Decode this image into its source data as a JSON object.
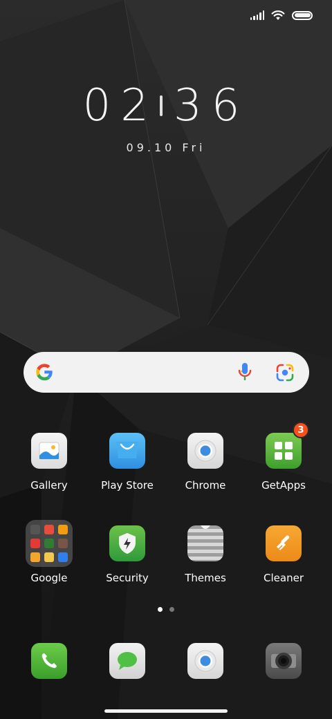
{
  "clock": {
    "hours": "02",
    "minutes": "36"
  },
  "date": {
    "text": "09.10 Fri"
  },
  "apps": [
    {
      "label": "Gallery"
    },
    {
      "label": "Play Store"
    },
    {
      "label": "Chrome"
    },
    {
      "label": "GetApps",
      "badge": "3"
    },
    {
      "label": "Google"
    },
    {
      "label": "Security"
    },
    {
      "label": "Themes"
    },
    {
      "label": "Cleaner"
    }
  ],
  "dock": [
    {
      "icon": "phone-icon"
    },
    {
      "icon": "messaging-icon"
    },
    {
      "icon": "chrome-icon"
    },
    {
      "icon": "camera-icon"
    }
  ],
  "page_indicator": {
    "pages": 2,
    "current": 1
  },
  "colors": {
    "badge": "#f4511e",
    "search_bar": "#f2f2f2",
    "green_tile": "#4caf50",
    "orange_tile": "#f39a1e",
    "play_store_blue": "#3aa0e8"
  }
}
